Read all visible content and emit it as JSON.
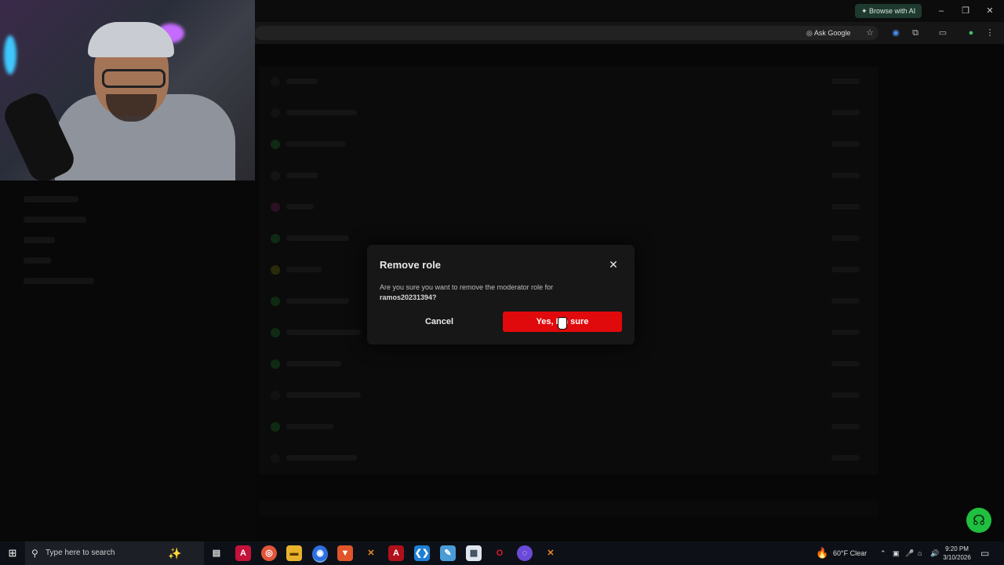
{
  "browser": {
    "browse_ai_label": "Browse with AI",
    "ask_google_label": "Ask Google",
    "window_controls": [
      "minimize",
      "restore",
      "close"
    ]
  },
  "modal": {
    "title": "Remove role",
    "message": "Are you sure you want to remove the moderator role for",
    "username": "ramos20231394?",
    "cancel_label": "Cancel",
    "confirm_label": "Yes, I'm sure",
    "confirm_color": "#e0090c"
  },
  "help": {
    "icon": "headset-icon",
    "color": "#1fbf3f"
  },
  "taskbar": {
    "search_placeholder": "Type here to search",
    "weather": "60°F  Clear",
    "time": "9:20 PM",
    "date": "3/10/2026",
    "apps": [
      "task-view-icon",
      "app-a-icon",
      "app-circle-icon",
      "file-explorer-icon",
      "chrome-icon",
      "brave-icon",
      "app-x-icon",
      "app-a2-icon",
      "vscode-icon",
      "app-pen-icon",
      "app-doc-icon",
      "opera-icon",
      "app-chat-icon",
      "app-x2-icon"
    ]
  }
}
